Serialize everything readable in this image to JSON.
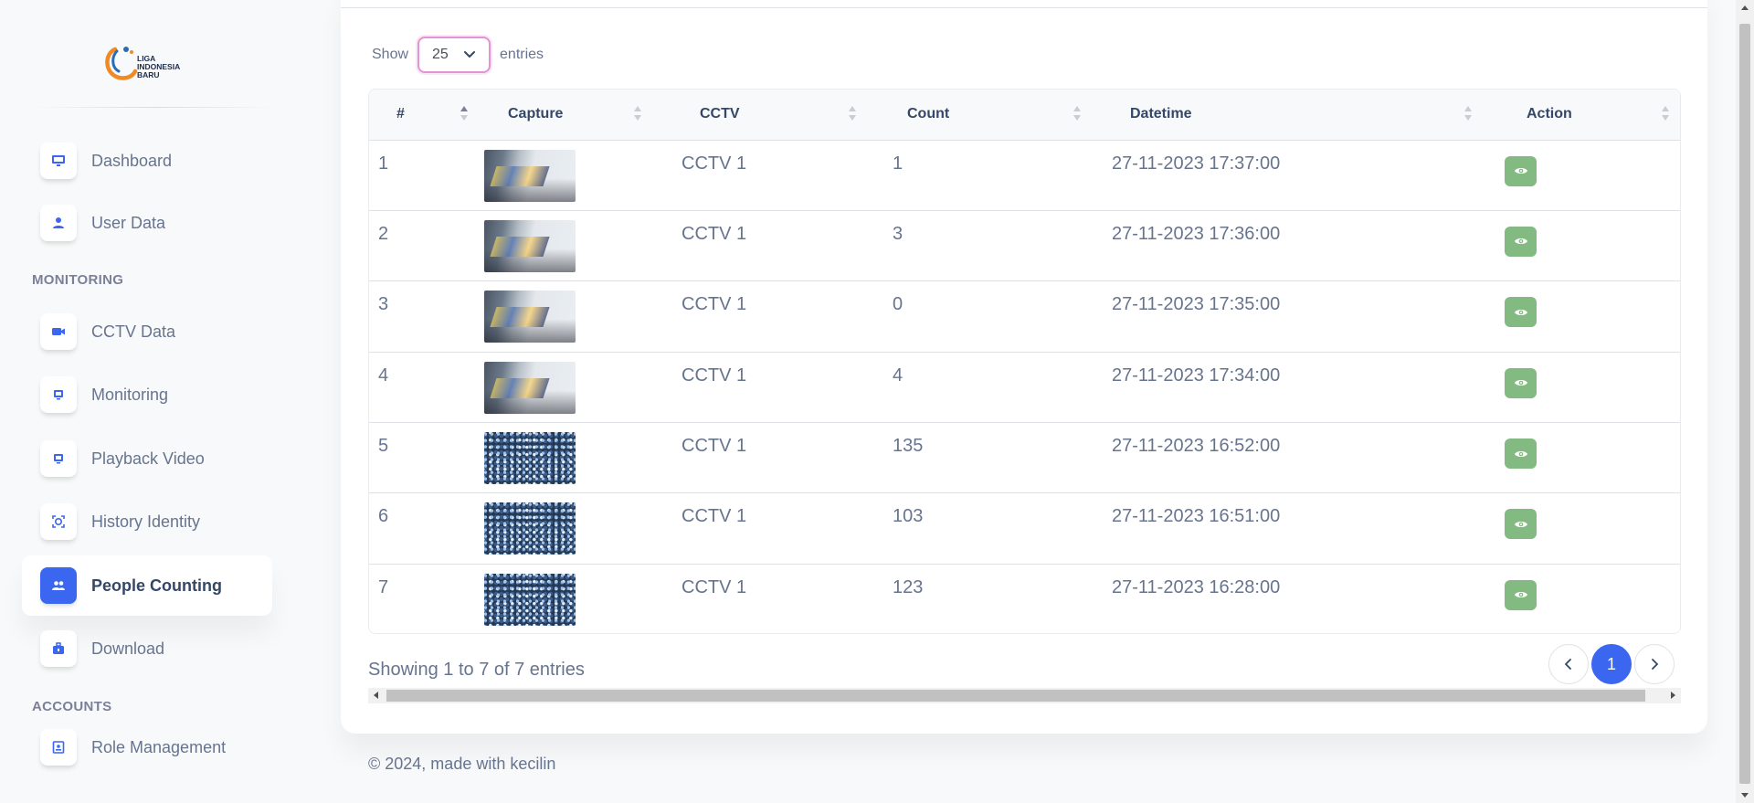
{
  "brand": {
    "logo_text": [
      "LIGA",
      "INDONESIA",
      "BARU"
    ]
  },
  "sidebar": {
    "items": [
      {
        "label": "Dashboard",
        "icon": "monitor-icon",
        "active": false
      },
      {
        "label": "User Data",
        "icon": "user-icon",
        "active": false
      },
      {
        "label": "CCTV Data",
        "icon": "video-camera-icon",
        "active": false
      },
      {
        "label": "Monitoring",
        "icon": "monitor-icon",
        "active": false
      },
      {
        "label": "Playback Video",
        "icon": "monitor-icon",
        "active": false
      },
      {
        "label": "History Identity",
        "icon": "face-scan-icon",
        "active": false
      },
      {
        "label": "People Counting",
        "icon": "users-icon",
        "active": true
      },
      {
        "label": "Download",
        "icon": "briefcase-icon",
        "active": false
      },
      {
        "label": "Role Management",
        "icon": "id-card-icon",
        "active": false
      }
    ],
    "sections": {
      "monitoring": "MONITORING",
      "accounts": "ACCOUNTS"
    }
  },
  "table_controls": {
    "show_label": "Show",
    "entries_value": "25",
    "entries_label": "entries"
  },
  "table": {
    "columns": [
      "#",
      "Capture",
      "CCTV",
      "Count",
      "Datetime",
      "Action"
    ],
    "rows": [
      {
        "no": "1",
        "capture": "crowd-gate",
        "cctv": "CCTV 1",
        "count": "1",
        "datetime": "27-11-2023 17:37:00"
      },
      {
        "no": "2",
        "capture": "crowd-gate",
        "cctv": "CCTV 1",
        "count": "3",
        "datetime": "27-11-2023 17:36:00"
      },
      {
        "no": "3",
        "capture": "crowd-gate",
        "cctv": "CCTV 1",
        "count": "0",
        "datetime": "27-11-2023 17:35:00"
      },
      {
        "no": "4",
        "capture": "crowd-gate",
        "cctv": "CCTV 1",
        "count": "4",
        "datetime": "27-11-2023 17:34:00"
      },
      {
        "no": "5",
        "capture": "crowd-stand",
        "cctv": "CCTV 1",
        "count": "135",
        "datetime": "27-11-2023 16:52:00"
      },
      {
        "no": "6",
        "capture": "crowd-stand",
        "cctv": "CCTV 1",
        "count": "103",
        "datetime": "27-11-2023 16:51:00"
      },
      {
        "no": "7",
        "capture": "crowd-stand",
        "cctv": "CCTV 1",
        "count": "123",
        "datetime": "27-11-2023 16:28:00"
      }
    ],
    "action_icon": "eye-icon"
  },
  "pagination": {
    "summary": "Showing 1 to 7 of 7 entries",
    "current_page": "1"
  },
  "footer": {
    "text": "© 2024, made with kecilin"
  },
  "colors": {
    "primary": "#3a66f0",
    "view_button": "#82ba82",
    "select_focus": "#e293d3"
  }
}
